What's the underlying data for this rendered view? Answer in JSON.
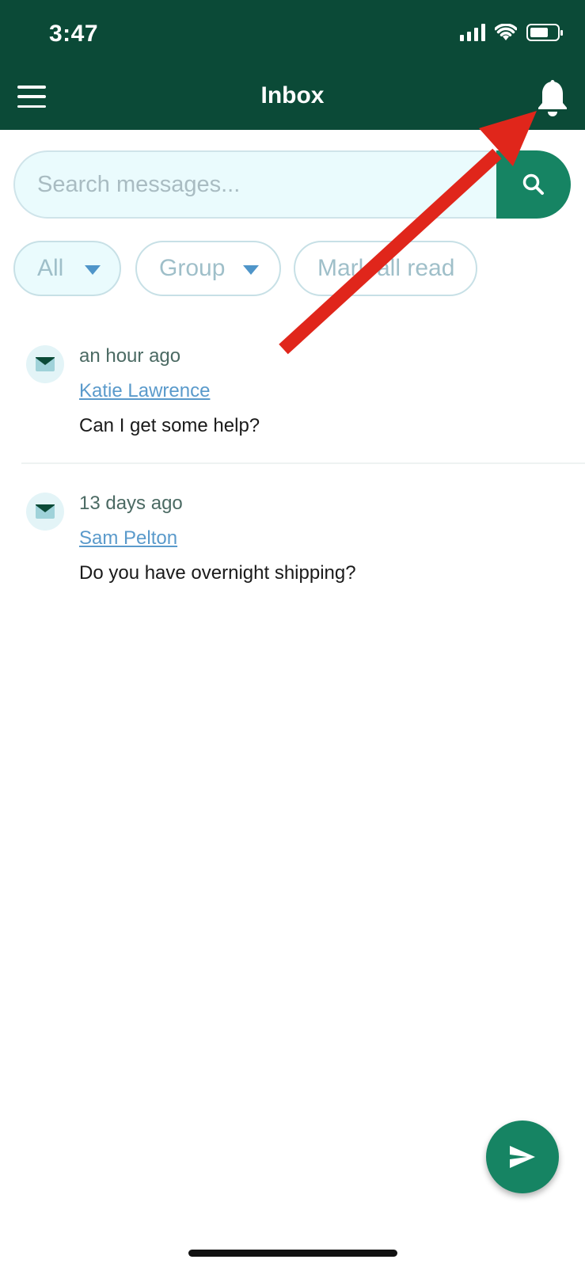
{
  "status_bar": {
    "time": "3:47"
  },
  "header": {
    "title": "Inbox"
  },
  "search": {
    "placeholder": "Search messages..."
  },
  "filters": [
    {
      "label": "All",
      "dropdown": true,
      "active": true
    },
    {
      "label": "Group",
      "dropdown": true,
      "active": false
    },
    {
      "label": "Mark all read",
      "dropdown": false,
      "active": false
    }
  ],
  "messages": [
    {
      "time": "an hour ago",
      "sender": "Katie Lawrence",
      "preview": "Can I get some help?"
    },
    {
      "time": "13 days ago",
      "sender": "Sam Pelton",
      "preview": "Do you have overnight shipping?"
    }
  ],
  "colors": {
    "header_bg": "#0b4a37",
    "accent": "#168463",
    "link": "#5a9acb",
    "annotation_arrow": "#e0261b"
  },
  "icons": {
    "menu": "hamburger-icon",
    "notifications": "bell-icon",
    "search": "search-icon",
    "message": "envelope-icon",
    "compose": "send-icon"
  }
}
